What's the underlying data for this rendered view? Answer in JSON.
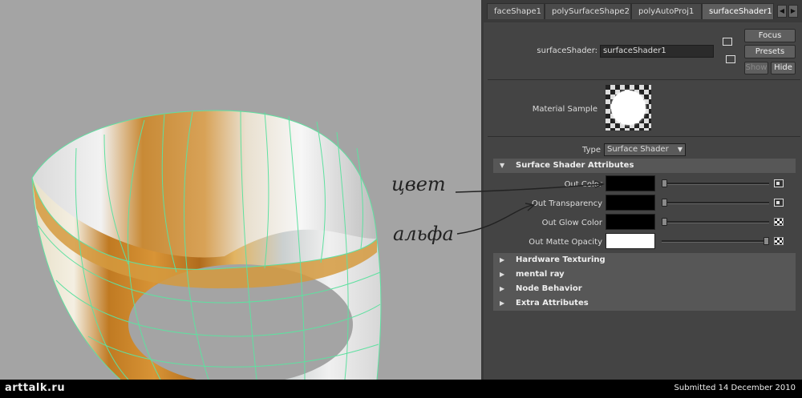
{
  "tabs": [
    "faceShape1",
    "polySurfaceShape2",
    "polyAutoProj1",
    "surfaceShader1"
  ],
  "active_tab": "surfaceShader1",
  "node": {
    "label": "surfaceShader:",
    "value": "surfaceShader1"
  },
  "buttons": {
    "focus": "Focus",
    "presets": "Presets",
    "show": "Show",
    "hide": "Hide"
  },
  "material_sample_label": "Material Sample",
  "type": {
    "label": "Type",
    "value": "Surface Shader"
  },
  "sections": {
    "surface": "Surface Shader Attributes",
    "hardware": "Hardware Texturing",
    "mentalray": "mental ray",
    "node": "Node Behavior",
    "extra": "Extra Attributes"
  },
  "attributes": [
    {
      "label": "Out Color",
      "color": "#000000",
      "slider": 0.0
    },
    {
      "label": "Out Transparency",
      "color": "#000000",
      "slider": 0.0
    },
    {
      "label": "Out Glow Color",
      "color": "#000000",
      "slider": 0.0
    },
    {
      "label": "Out Matte Opacity",
      "color": "#ffffff",
      "slider": 1.0
    }
  ],
  "annotations": {
    "color": "цвет",
    "alpha": "альфа"
  },
  "footer": {
    "logo": "arttalk.ru",
    "submitted": "Submitted 14 December 2010"
  },
  "colors": {
    "wireframe": "#5fe0a0",
    "viewport_bg": "#a4a4a4",
    "panel_bg": "#444444"
  }
}
